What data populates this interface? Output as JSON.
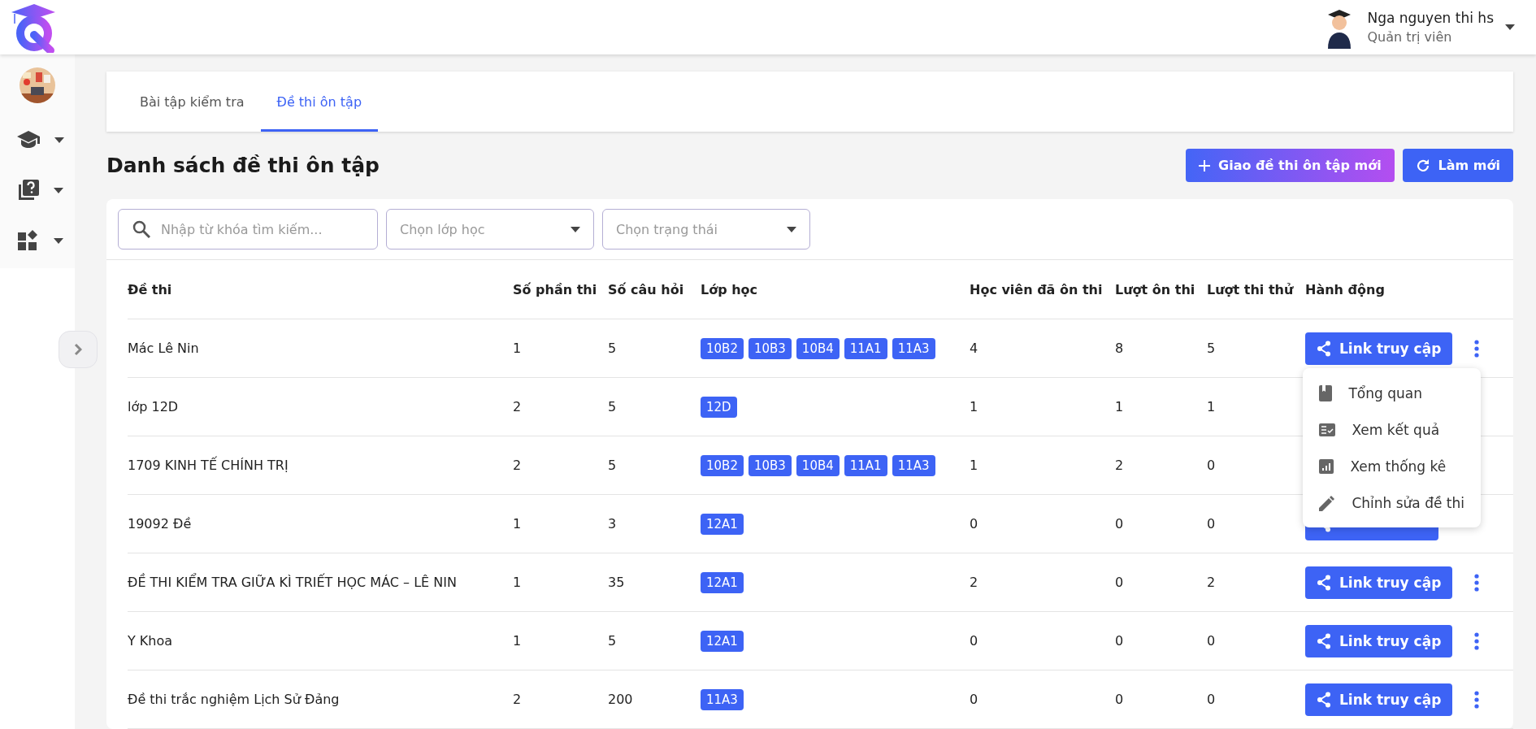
{
  "user": {
    "name": "Nga nguyen thi hs",
    "role": "Quản trị viên"
  },
  "sidebar": {
    "items": [
      {
        "kind": "picture"
      },
      {
        "kind": "menu",
        "expanded": false
      },
      {
        "kind": "menu",
        "expanded": false
      },
      {
        "kind": "menu",
        "expanded": false
      }
    ]
  },
  "tabs": [
    {
      "label": "Bài tập kiểm tra",
      "selected": false
    },
    {
      "label": "Đề thi ôn tập",
      "selected": true
    }
  ],
  "page_title": "Danh sách đề thi ôn tập",
  "buttons": [
    {
      "label": "Giao đề thi ôn tập mới",
      "kind": "add"
    },
    {
      "label": "Làm mới",
      "kind": "refresh"
    }
  ],
  "filters": [
    {
      "kind": "search",
      "placeholder": "Nhập từ khóa tìm kiếm..."
    },
    {
      "kind": "select",
      "placeholder": "Chọn lớp học"
    },
    {
      "kind": "select",
      "placeholder": "Chọn trạng thái"
    }
  ],
  "table": {
    "columns": [
      "Đề thi",
      "Số phần thi",
      "Số câu hỏi",
      "Lớp học",
      "Học viên đã ôn thi",
      "Lượt ôn thi",
      "Lượt thi thử",
      "Hành động"
    ],
    "rows": [
      {
        "name": "Mác Lê Nin",
        "parts": "1",
        "questions": "5",
        "classes": [
          "10B2",
          "10B3",
          "10B4",
          "11A1",
          "11A3"
        ],
        "students": "4",
        "reviews": "8",
        "trials": "5",
        "action": "Link truy cập",
        "more": true
      },
      {
        "name": "lớp 12D",
        "parts": "2",
        "questions": "5",
        "classes": [
          "12D"
        ],
        "students": "1",
        "reviews": "1",
        "trials": "1"
      },
      {
        "name": "1709 KINH TẾ CHÍNH TRỊ",
        "parts": "2",
        "questions": "5",
        "classes": [
          "10B2",
          "10B3",
          "10B4",
          "11A1",
          "11A3"
        ],
        "students": "1",
        "reviews": "2",
        "trials": "0"
      },
      {
        "name": "19092 Đề",
        "parts": "1",
        "questions": "3",
        "classes": [
          "12A1"
        ],
        "students": "0",
        "reviews": "0",
        "trials": "0",
        "action": "",
        "more": false
      },
      {
        "name": "ĐỀ THI KIỂM TRA GIỮA KÌ TRIẾT HỌC MÁC – LÊ NIN",
        "parts": "1",
        "questions": "35",
        "classes": [
          "12A1"
        ],
        "students": "2",
        "reviews": "0",
        "trials": "2",
        "action": "Link truy cập",
        "more": true
      },
      {
        "name": "Y Khoa",
        "parts": "1",
        "questions": "5",
        "classes": [
          "12A1"
        ],
        "students": "0",
        "reviews": "0",
        "trials": "0",
        "action": "Link truy cập",
        "more": true
      },
      {
        "name": "Đề thi trắc nghiệm Lịch Sử Đảng",
        "parts": "2",
        "questions": "200",
        "classes": [
          "11A3"
        ],
        "students": "0",
        "reviews": "0",
        "trials": "0",
        "action": "Link truy cập",
        "more": true
      }
    ]
  },
  "row_menu": {
    "items": [
      "Tổng quan",
      "Xem kết quả",
      "Xem thống kê",
      "Chỉnh sửa đề thi"
    ]
  }
}
